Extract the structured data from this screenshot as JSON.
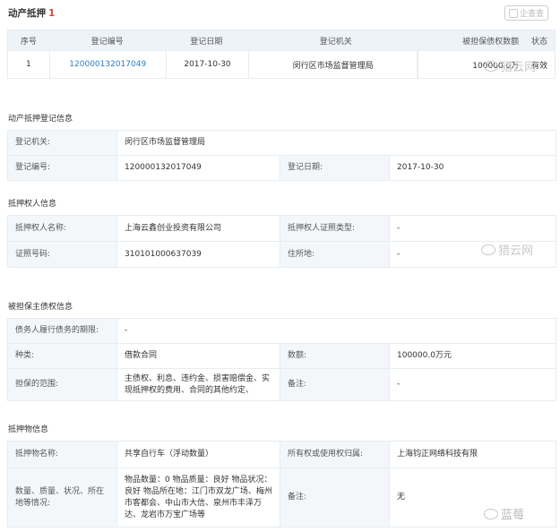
{
  "header": {
    "title": "动产抵押",
    "count": "1",
    "brand": "企查查"
  },
  "list": {
    "columns": [
      "序号",
      "登记编号",
      "登记日期",
      "登记机关",
      "被担保债权数额",
      "状态"
    ],
    "rows": [
      {
        "index": "1",
        "reg_no": "120000132017049",
        "date": "2017-10-30",
        "authority": "闵行区市场监督管理局",
        "amount": "100000.0万",
        "status": "有效"
      }
    ]
  },
  "reg_info": {
    "title": "动产抵押登记信息",
    "authority_label": "登记机关:",
    "authority_value": "闵行区市场监督管理局",
    "reg_no_label": "登记编号:",
    "reg_no_value": "120000132017049",
    "date_label": "登记日期:",
    "date_value": "2017-10-30"
  },
  "mortgagee": {
    "title": "抵押权人信息",
    "name_label": "抵押权人名称:",
    "name_value": "上海云鑫创业投资有限公司",
    "id_type_label": "抵押权人证照类型:",
    "id_type_value": "-",
    "id_no_label": "证照号码:",
    "id_no_value": "310101000637039",
    "address_label": "住所地:",
    "address_value": "-"
  },
  "debt": {
    "title": "被担保主债权信息",
    "term_label": "债务人履行债务的期限:",
    "term_value": "-",
    "type_label": "种类:",
    "type_value": "借款合同",
    "amount_label": "数额:",
    "amount_value": "100000.0万元",
    "scope_label": "担保的范围:",
    "scope_value": "主债权、利息、违约金、损害赔偿金、实现抵押权的费用、合同的其他约定、",
    "remark_label": "备注:",
    "remark_value": "-"
  },
  "collateral": {
    "title": "抵押物信息",
    "name_label": "抵押物名称:",
    "name_value": "共享自行车（浮动数量）",
    "owner_label": "所有权或使用权归属:",
    "owner_value": "上海钧正网络科技有限",
    "qty_label": "数量、质量、状况、所在地等情况:",
    "qty_value": "物品数量：0 物品质量：良好 物品状况：良好 物品所在地：江门市双龙广场、梅州市客都会、中山市大信、泉州市丰泽万达、龙岩市万宝广场等",
    "remark_label": "备注:",
    "remark_value": "无"
  },
  "watermarks": {
    "text": "猎云网",
    "bottom_text": "蓝莓"
  }
}
